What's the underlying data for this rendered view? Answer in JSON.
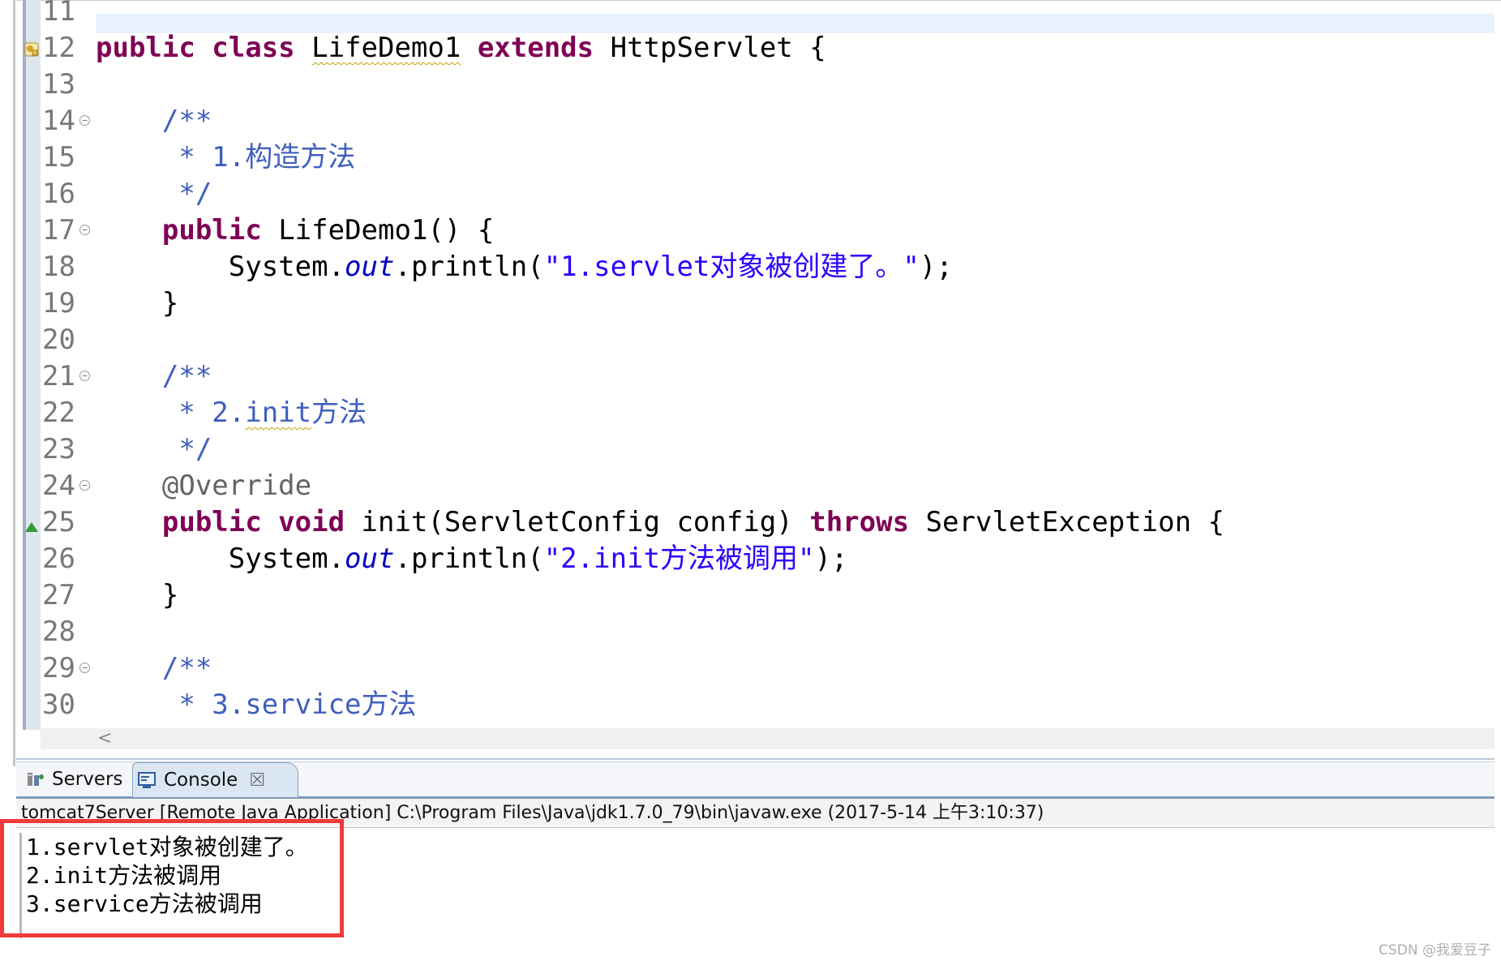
{
  "editor": {
    "lines": [
      {
        "num": "11",
        "fold": false,
        "tokens": []
      },
      {
        "num": "12",
        "fold": false,
        "tokens": [
          {
            "t": "public class ",
            "c": "kw"
          },
          {
            "t": "LifeDemo1",
            "c": "squiggle"
          },
          {
            "t": " "
          },
          {
            "t": "extends",
            "c": "kw"
          },
          {
            "t": " HttpServlet {"
          }
        ]
      },
      {
        "num": "13",
        "fold": false,
        "tokens": []
      },
      {
        "num": "14",
        "fold": true,
        "tokens": [
          {
            "t": "    /**",
            "c": "cm"
          }
        ]
      },
      {
        "num": "15",
        "fold": false,
        "tokens": [
          {
            "t": "     * 1.构造方法",
            "c": "cm"
          }
        ]
      },
      {
        "num": "16",
        "fold": false,
        "tokens": [
          {
            "t": "     */",
            "c": "cm"
          }
        ]
      },
      {
        "num": "17",
        "fold": true,
        "tokens": [
          {
            "t": "    "
          },
          {
            "t": "public",
            "c": "kw"
          },
          {
            "t": " LifeDemo1() {"
          }
        ]
      },
      {
        "num": "18",
        "fold": false,
        "tokens": [
          {
            "t": "        System."
          },
          {
            "t": "out",
            "c": "fld"
          },
          {
            "t": ".println("
          },
          {
            "t": "\"1.servlet对象被创建了。\"",
            "c": "str"
          },
          {
            "t": ");"
          }
        ]
      },
      {
        "num": "19",
        "fold": false,
        "tokens": [
          {
            "t": "    }"
          }
        ]
      },
      {
        "num": "20",
        "fold": false,
        "tokens": []
      },
      {
        "num": "21",
        "fold": true,
        "tokens": [
          {
            "t": "    /**",
            "c": "cm"
          }
        ]
      },
      {
        "num": "22",
        "fold": false,
        "tokens": [
          {
            "t": "     * 2.",
            "c": "cm"
          },
          {
            "t": "init",
            "c": "cm squiggle"
          },
          {
            "t": "方法",
            "c": "cm"
          }
        ]
      },
      {
        "num": "23",
        "fold": false,
        "tokens": [
          {
            "t": "     */",
            "c": "cm"
          }
        ]
      },
      {
        "num": "24",
        "fold": true,
        "tokens": [
          {
            "t": "    "
          },
          {
            "t": "@Override",
            "c": "ann"
          }
        ]
      },
      {
        "num": "25",
        "fold": false,
        "tokens": [
          {
            "t": "    "
          },
          {
            "t": "public void",
            "c": "kw"
          },
          {
            "t": " init(ServletConfig config) "
          },
          {
            "t": "throws",
            "c": "kw"
          },
          {
            "t": " ServletException {"
          }
        ]
      },
      {
        "num": "26",
        "fold": false,
        "tokens": [
          {
            "t": "        System."
          },
          {
            "t": "out",
            "c": "fld"
          },
          {
            "t": ".println("
          },
          {
            "t": "\"2.init方法被调用\"",
            "c": "str"
          },
          {
            "t": ");"
          }
        ]
      },
      {
        "num": "27",
        "fold": false,
        "tokens": [
          {
            "t": "    }"
          }
        ]
      },
      {
        "num": "28",
        "fold": false,
        "tokens": []
      },
      {
        "num": "29",
        "fold": true,
        "tokens": [
          {
            "t": "    /**",
            "c": "cm"
          }
        ]
      },
      {
        "num": "30",
        "fold": false,
        "tokens": [
          {
            "t": "     * 3.service方法",
            "c": "cm"
          }
        ]
      }
    ],
    "scroll_left_glyph": "<"
  },
  "console": {
    "tabs": {
      "servers_label": "Servers",
      "console_label": "Console",
      "close_glyph": "☒"
    },
    "launch_info": "tomcat7Server [Remote Java Application] C:\\Program Files\\Java\\jdk1.7.0_79\\bin\\javaw.exe (2017-5-14 上午3:10:37)",
    "output": [
      "1.servlet对象被创建了。",
      "2.init方法被调用",
      "3.service方法被调用"
    ]
  },
  "watermark": "CSDN @我爱豆子",
  "colors": {
    "keyword": "#7f0055",
    "comment": "#3f5fbf",
    "string": "#2a00ff",
    "field": "#0000c0",
    "annotation": "#646464",
    "highlight_box": "#f23a3a"
  }
}
